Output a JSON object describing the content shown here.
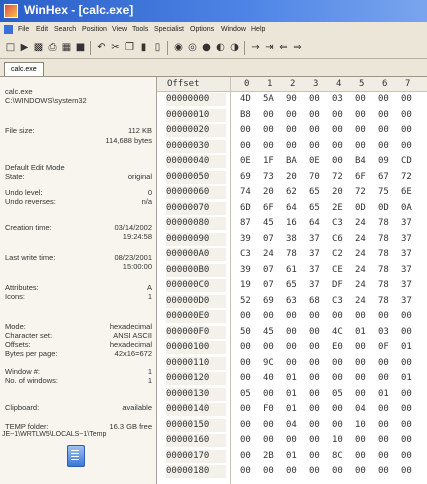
{
  "window": {
    "title": "WinHex - [calc.exe]"
  },
  "menu": [
    "File",
    "Edit",
    "Search",
    "Position",
    "View",
    "Tools",
    "Specialist",
    "Options",
    "Window",
    "Help"
  ],
  "toolbar_icons": [
    "new-file-icon",
    "open-icon",
    "save-icon",
    "print-icon",
    "properties-icon",
    "undo-icon",
    "cut-icon",
    "copy-icon",
    "paste-icon",
    "paste-special-icon",
    "find-text-icon",
    "find-hex-icon",
    "replace-text-icon",
    "replace-hex-icon",
    "find-next-icon",
    "goto-offset-icon",
    "goto-sector-icon",
    "back-icon",
    "forward-icon"
  ],
  "tabs": [
    "calc.exe"
  ],
  "info": {
    "file_name": "calc.exe",
    "file_path": "C:\\WINDOWS\\system32",
    "file_size_label": "File size:",
    "file_size_kb": "112 KB",
    "file_size_bytes": "114,688 bytes",
    "default_edit_mode_label": "Default Edit Mode",
    "state_label": "State:",
    "state_value": "original",
    "undo_level_label": "Undo level:",
    "undo_level_value": "0",
    "undo_reverses_label": "Undo reverses:",
    "undo_reverses_value": "n/a",
    "creation_time_label": "Creation time:",
    "creation_date": "03/14/2002",
    "creation_time": "19:24:58",
    "last_write_label": "Last write time:",
    "last_write_date": "08/23/2001",
    "last_write_time": "15:00:00",
    "attributes_label": "Attributes:",
    "attributes_value": "A",
    "icons_label": "Icons:",
    "icons_value": "1",
    "mode_label": "Mode:",
    "mode_value": "hexadecimal",
    "charset_label": "Character set:",
    "charset_value": "ANSI ASCII",
    "offsets_label": "Offsets:",
    "offsets_value": "hexadecimal",
    "bytes_per_page_label": "Bytes per page:",
    "bytes_per_page_value": "42x16=672",
    "window_num_label": "Window #:",
    "window_num_value": "1",
    "num_windows_label": "No. of windows:",
    "num_windows_value": "1",
    "clipboard_label": "Clipboard:",
    "clipboard_value": "available",
    "temp_folder_label": "TEMP folder:",
    "temp_folder_free": "16.3 GB free",
    "temp_folder_path": "JE~1\\WRTLW5\\LOCALS~1\\Temp"
  },
  "hex": {
    "offset_header": "Offset",
    "columns": [
      "0",
      "1",
      "2",
      "3",
      "4",
      "5",
      "6",
      "7"
    ],
    "rows": [
      {
        "addr": "00000000",
        "bytes": [
          "4D",
          "5A",
          "90",
          "00",
          "03",
          "00",
          "00",
          "00"
        ]
      },
      {
        "addr": "00000010",
        "bytes": [
          "B8",
          "00",
          "00",
          "00",
          "00",
          "00",
          "00",
          "00"
        ]
      },
      {
        "addr": "00000020",
        "bytes": [
          "00",
          "00",
          "00",
          "00",
          "00",
          "00",
          "00",
          "00"
        ]
      },
      {
        "addr": "00000030",
        "bytes": [
          "00",
          "00",
          "00",
          "00",
          "00",
          "00",
          "00",
          "00"
        ]
      },
      {
        "addr": "00000040",
        "bytes": [
          "0E",
          "1F",
          "BA",
          "0E",
          "00",
          "B4",
          "09",
          "CD"
        ]
      },
      {
        "addr": "00000050",
        "bytes": [
          "69",
          "73",
          "20",
          "70",
          "72",
          "6F",
          "67",
          "72"
        ]
      },
      {
        "addr": "00000060",
        "bytes": [
          "74",
          "20",
          "62",
          "65",
          "20",
          "72",
          "75",
          "6E"
        ]
      },
      {
        "addr": "00000070",
        "bytes": [
          "6D",
          "6F",
          "64",
          "65",
          "2E",
          "0D",
          "0D",
          "0A"
        ]
      },
      {
        "addr": "00000080",
        "bytes": [
          "87",
          "45",
          "16",
          "64",
          "C3",
          "24",
          "78",
          "37"
        ]
      },
      {
        "addr": "00000090",
        "bytes": [
          "39",
          "07",
          "38",
          "37",
          "C6",
          "24",
          "78",
          "37"
        ]
      },
      {
        "addr": "000000A0",
        "bytes": [
          "C3",
          "24",
          "78",
          "37",
          "C2",
          "24",
          "78",
          "37"
        ]
      },
      {
        "addr": "000000B0",
        "bytes": [
          "39",
          "07",
          "61",
          "37",
          "CE",
          "24",
          "78",
          "37"
        ]
      },
      {
        "addr": "000000C0",
        "bytes": [
          "19",
          "07",
          "65",
          "37",
          "DF",
          "24",
          "78",
          "37"
        ]
      },
      {
        "addr": "000000D0",
        "bytes": [
          "52",
          "69",
          "63",
          "68",
          "C3",
          "24",
          "78",
          "37"
        ]
      },
      {
        "addr": "000000E0",
        "bytes": [
          "00",
          "00",
          "00",
          "00",
          "00",
          "00",
          "00",
          "00"
        ]
      },
      {
        "addr": "000000F0",
        "bytes": [
          "50",
          "45",
          "00",
          "00",
          "4C",
          "01",
          "03",
          "00"
        ]
      },
      {
        "addr": "00000100",
        "bytes": [
          "00",
          "00",
          "00",
          "00",
          "E0",
          "00",
          "0F",
          "01"
        ]
      },
      {
        "addr": "00000110",
        "bytes": [
          "00",
          "9C",
          "00",
          "00",
          "00",
          "00",
          "00",
          "00"
        ]
      },
      {
        "addr": "00000120",
        "bytes": [
          "00",
          "40",
          "01",
          "00",
          "00",
          "00",
          "00",
          "01"
        ]
      },
      {
        "addr": "00000130",
        "bytes": [
          "05",
          "00",
          "01",
          "00",
          "05",
          "00",
          "01",
          "00"
        ]
      },
      {
        "addr": "00000140",
        "bytes": [
          "00",
          "F0",
          "01",
          "00",
          "00",
          "04",
          "00",
          "00"
        ]
      },
      {
        "addr": "00000150",
        "bytes": [
          "00",
          "00",
          "04",
          "00",
          "00",
          "10",
          "00",
          "00"
        ]
      },
      {
        "addr": "00000160",
        "bytes": [
          "00",
          "00",
          "00",
          "00",
          "10",
          "00",
          "00",
          "00"
        ]
      },
      {
        "addr": "00000170",
        "bytes": [
          "00",
          "2B",
          "01",
          "00",
          "8C",
          "00",
          "00",
          "00"
        ]
      },
      {
        "addr": "00000180",
        "bytes": [
          "00",
          "00",
          "00",
          "00",
          "00",
          "00",
          "00",
          "00"
        ]
      }
    ]
  }
}
